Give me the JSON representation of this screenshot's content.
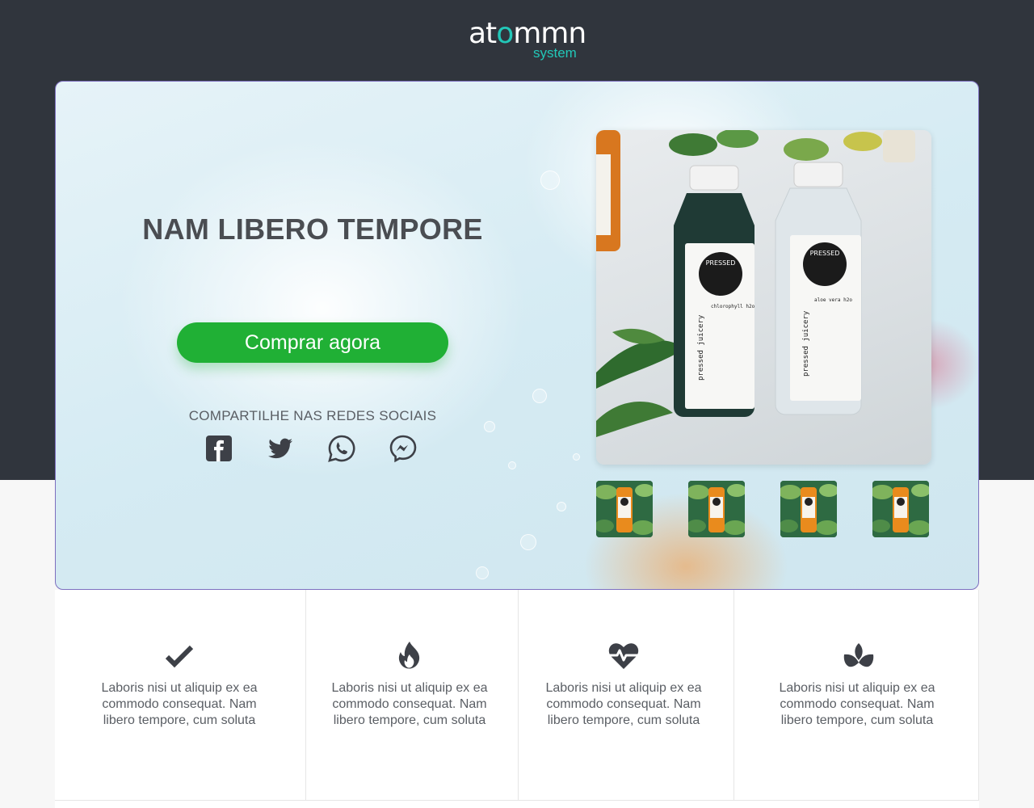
{
  "brand": {
    "logo_main_before": "at",
    "logo_main_o": "o",
    "logo_main_after": "mmn",
    "logo_sub": "system"
  },
  "hero": {
    "title": "NAM LIBERO TEMPORE",
    "cta_label": "Comprar agora",
    "share_label": "COMPARTILHE NAS REDES SOCIAIS",
    "social_icons": [
      "facebook-icon",
      "twitter-icon",
      "whatsapp-icon",
      "messenger-icon"
    ],
    "cta_color": "#20b035"
  },
  "product": {
    "bottle_left_brand": "pressed juicery",
    "bottle_left_flavor": "chlorophyll h2o",
    "bottle_right_brand": "pressed juicery",
    "bottle_right_flavor": "aloe vera h2o",
    "badge_text": "PRESSED"
  },
  "features": [
    {
      "icon": "check-icon",
      "text": "Laboris nisi ut aliquip ex ea commodo consequat. Nam libero tempore, cum soluta"
    },
    {
      "icon": "fire-icon",
      "text": "Laboris nisi ut aliquip ex ea commodo consequat. Nam libero tempore, cum soluta"
    },
    {
      "icon": "heartbeat-icon",
      "text": "Laboris nisi ut aliquip ex ea commodo consequat. Nam libero tempore, cum soluta"
    },
    {
      "icon": "spa-icon",
      "text": "Laboris nisi ut aliquip ex ea commodo consequat. Nam libero tempore, cum soluta"
    }
  ],
  "colors": {
    "header_bg": "#30353d",
    "accent": "#22c7b8",
    "text_dark": "#4a4d52"
  }
}
